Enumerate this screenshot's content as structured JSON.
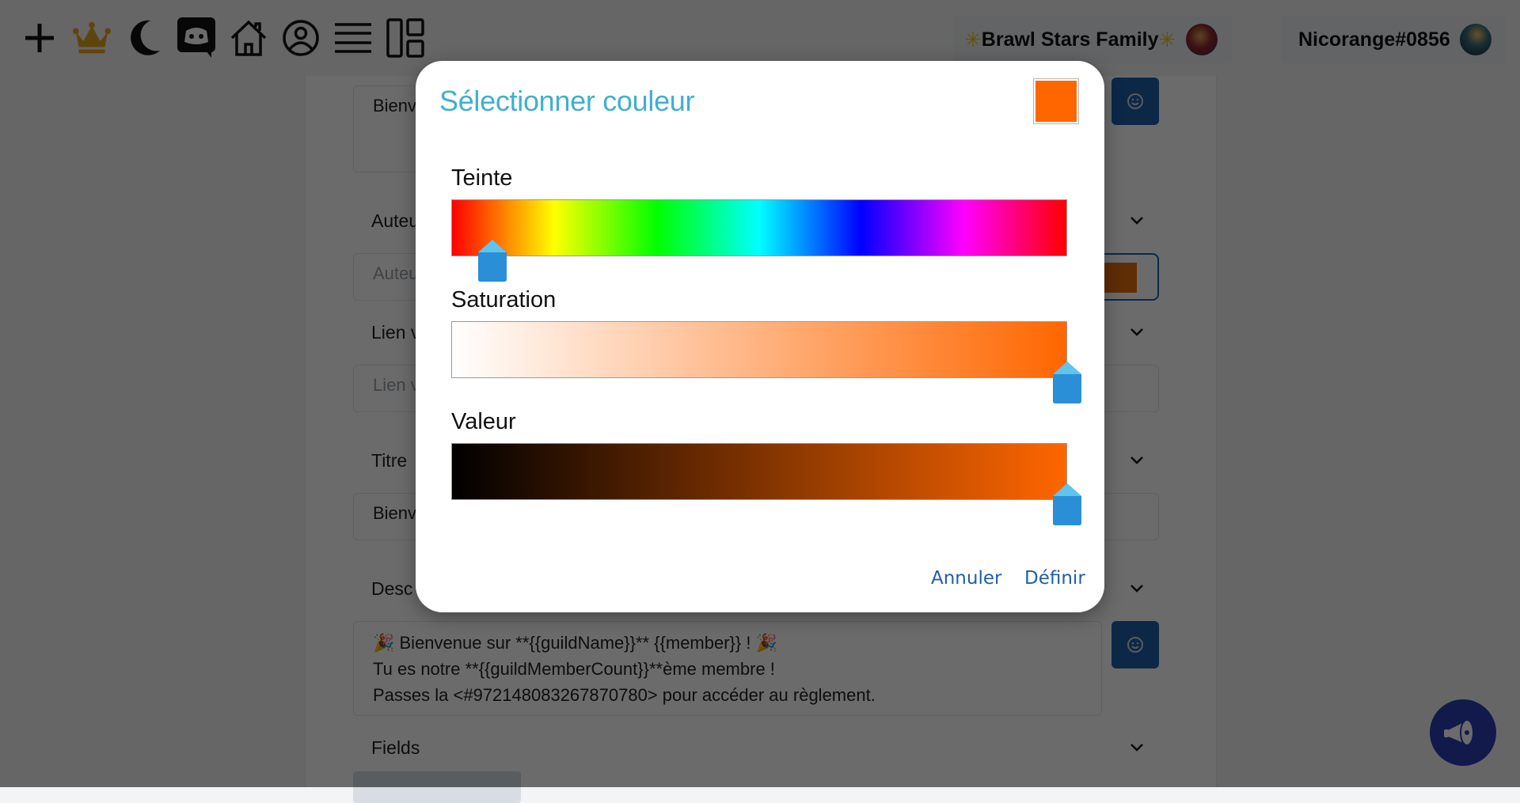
{
  "topbar": {
    "icons": [
      "plus-icon",
      "crown-icon",
      "moon-icon",
      "discord-icon",
      "home-icon",
      "user-circle-icon",
      "menu-icon",
      "layout-icon"
    ],
    "server": {
      "star_left": "✳",
      "name": "Brawl Stars Family",
      "star_right": "✳"
    },
    "user": {
      "name": "Nicorange#0856"
    }
  },
  "form": {
    "message_preview": "Bienv",
    "author_label": "Auteur",
    "author_placeholder": "Auteur",
    "link_label": "Lien v",
    "link_placeholder": "Lien v",
    "title_label": "Titre",
    "title_value": "Bienv",
    "description_label": "Desc",
    "description_lines": [
      "🎉 Bienvenue sur **{{guildName}}** {{member}} ! 🎉",
      "Tu es notre **{{guildMemberCount}}**ème membre !",
      "Passes la <#972148083267870780>  pour accéder au règlement."
    ],
    "fields_label": "Fields",
    "author_color": "#e36f0c"
  },
  "dialog": {
    "title": "Sélectionner couleur",
    "selected_color": "#ff6600",
    "hue_label": "Teinte",
    "saturation_label": "Saturation",
    "value_label": "Valeur",
    "hue_degrees": 24,
    "saturation": 1.0,
    "value": 1.0,
    "cancel_label": "Annuler",
    "confirm_label": "Définir"
  },
  "colors": {
    "title_accent": "#3fb0d0",
    "button_text": "#1f5ea8",
    "thumb": "#2a8fd6",
    "emoji_button": "#1d5fa8"
  }
}
